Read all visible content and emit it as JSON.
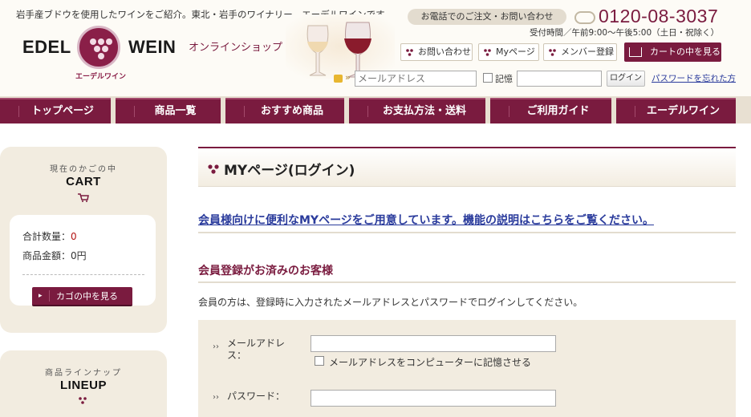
{
  "header": {
    "tagline": "岩手産ブドウを使用したワインをご紹介。東北・岩手のワイナリー、エーデルワインです。",
    "logo": {
      "word_left": "EDEL",
      "word_right": "WEIN",
      "small_text": "エーデルワイン"
    },
    "online_shop": "オンラインショップ",
    "contact_pill": "お電話でのご注文・お問い合わせ",
    "phone": "0120-08-3037",
    "hours": "受付時間／午前9:00〜午後5:00（土日・祝除く）",
    "buttons": {
      "contact": "お問い合わせ",
      "mypage": "Myページ",
      "member": "メンバー登録",
      "cart": "カートの中を見る"
    },
    "login": {
      "email_placeholder": "メールアドレス",
      "remember": "記憶",
      "login_button": "ログイン",
      "forgot": "パスワードを忘れた方"
    }
  },
  "nav": {
    "items": [
      {
        "label": "トップページ"
      },
      {
        "label": "商品一覧"
      },
      {
        "label": "おすすめ商品"
      },
      {
        "label": "お支払方法・送料"
      },
      {
        "label": "ご利用ガイド"
      },
      {
        "label": "エーデルワイン"
      }
    ]
  },
  "sidebar": {
    "cart": {
      "subtitle": "現在のかごの中",
      "title": "CART",
      "total_qty_label": "合計数量：",
      "total_qty_value": "0",
      "total_price_label": "商品金額：0円",
      "view_button": "カゴの中を見る"
    },
    "lineup": {
      "subtitle": "商品ラインナップ",
      "title": "LINEUP"
    }
  },
  "main": {
    "page_title": "MYページ(ログイン)",
    "info_link": "会員様向けに便利なMYページをご用意しています。機能の説明はこちらをご覧ください。",
    "section_heading": "会員登録がお済みのお客様",
    "description": "会員の方は、登録時に入力されたメールアドレスとパスワードでログインしてください。",
    "form": {
      "email_label_line1": "メールアドレ",
      "email_label_line2": "ス：",
      "remember_label": "メールアドレスをコンピューターに記憶させる",
      "password_label": "パスワード：",
      "marker": "››"
    }
  },
  "colors": {
    "brand": "#7a1b3f",
    "beige": "#f2ece0",
    "link": "#2a3b9c",
    "alert_red": "#b31414"
  }
}
